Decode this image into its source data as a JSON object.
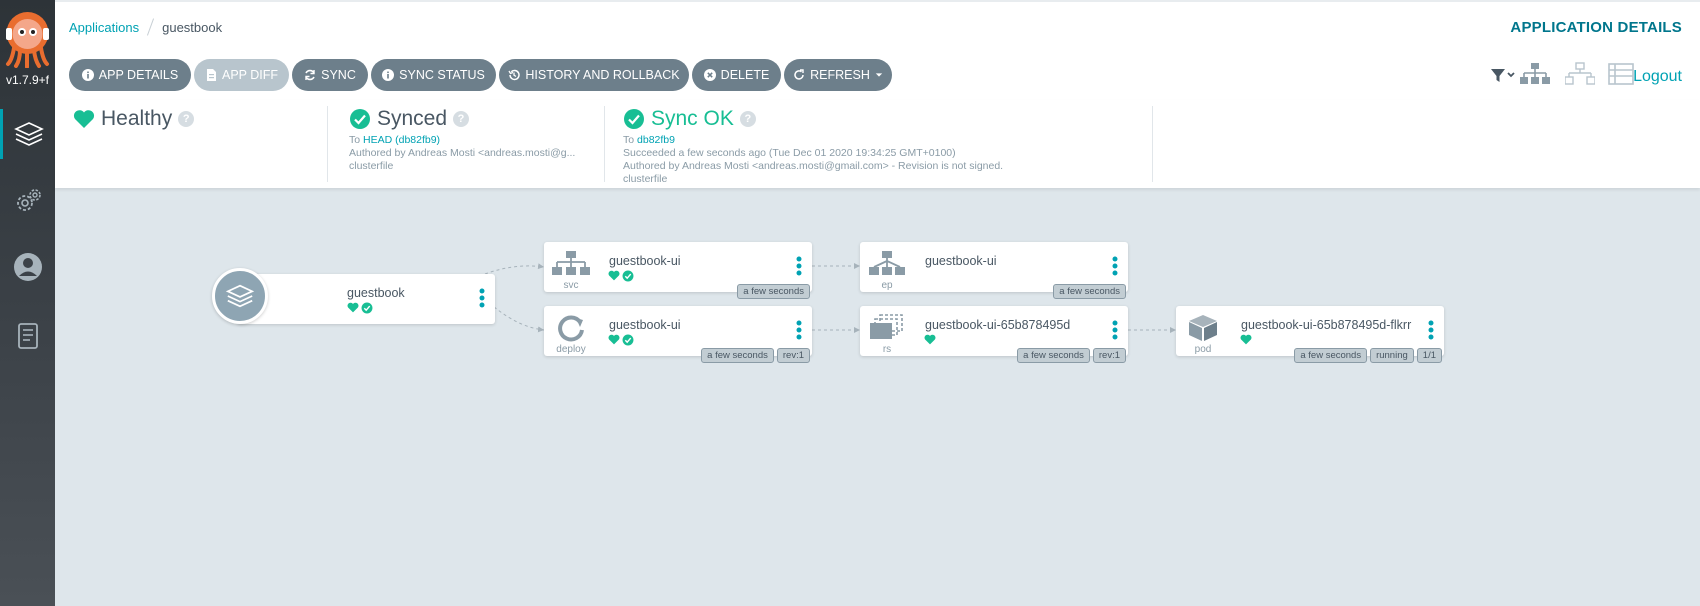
{
  "sidebar": {
    "version": "v1.7.9+f"
  },
  "breadcrumb": {
    "parent": "Applications",
    "current": "guestbook"
  },
  "header": {
    "title": "APPLICATION DETAILS"
  },
  "toolbar": {
    "buttons": [
      {
        "label": "APP DETAILS",
        "icon": "info-icon"
      },
      {
        "label": "APP DIFF",
        "icon": "file-diff-icon"
      },
      {
        "label": "SYNC",
        "icon": "sync-icon"
      },
      {
        "label": "SYNC STATUS",
        "icon": "info-icon"
      },
      {
        "label": "HISTORY AND ROLLBACK",
        "icon": "history-icon"
      },
      {
        "label": "DELETE",
        "icon": "delete-circle-icon"
      },
      {
        "label": "REFRESH",
        "icon": "refresh-icon"
      }
    ],
    "logout": "Logout"
  },
  "status": {
    "health": {
      "label": "Healthy"
    },
    "sync": {
      "label": "Synced",
      "to_prefix": "To",
      "revision": "HEAD (db82fb9)",
      "author": "Authored by Andreas Mosti <andreas.mosti@g...",
      "message": "clusterfile"
    },
    "operation": {
      "label": "Sync OK",
      "to_prefix": "To",
      "revision": "db82fb9",
      "time": "Succeeded a few seconds ago (Tue Dec 01 2020 19:34:25 GMT+0100)",
      "author": "Authored by Andreas Mosti <andreas.mosti@gmail.com> - Revision is not signed.",
      "message": "clusterfile"
    }
  },
  "graph": {
    "app": {
      "name": "guestbook"
    },
    "svc": {
      "kind": "svc",
      "name": "guestbook-ui",
      "tags": [
        "a few seconds"
      ]
    },
    "deploy": {
      "kind": "deploy",
      "name": "guestbook-ui",
      "tags": [
        "a few seconds",
        "rev:1"
      ]
    },
    "ep": {
      "kind": "ep",
      "name": "guestbook-ui",
      "tags": [
        "a few seconds"
      ]
    },
    "rs": {
      "kind": "rs",
      "name": "guestbook-ui-65b878495d",
      "tags": [
        "a few seconds",
        "rev:1"
      ]
    },
    "pod": {
      "kind": "pod",
      "name": "guestbook-ui-65b878495d-flkrr",
      "tags": [
        "a few seconds",
        "running",
        "1/1"
      ]
    }
  },
  "colors": {
    "accent": "#00a2b3",
    "healthy": "#18be94",
    "button": "#6d7f8b",
    "button_disabled": "#b8c5cd"
  }
}
